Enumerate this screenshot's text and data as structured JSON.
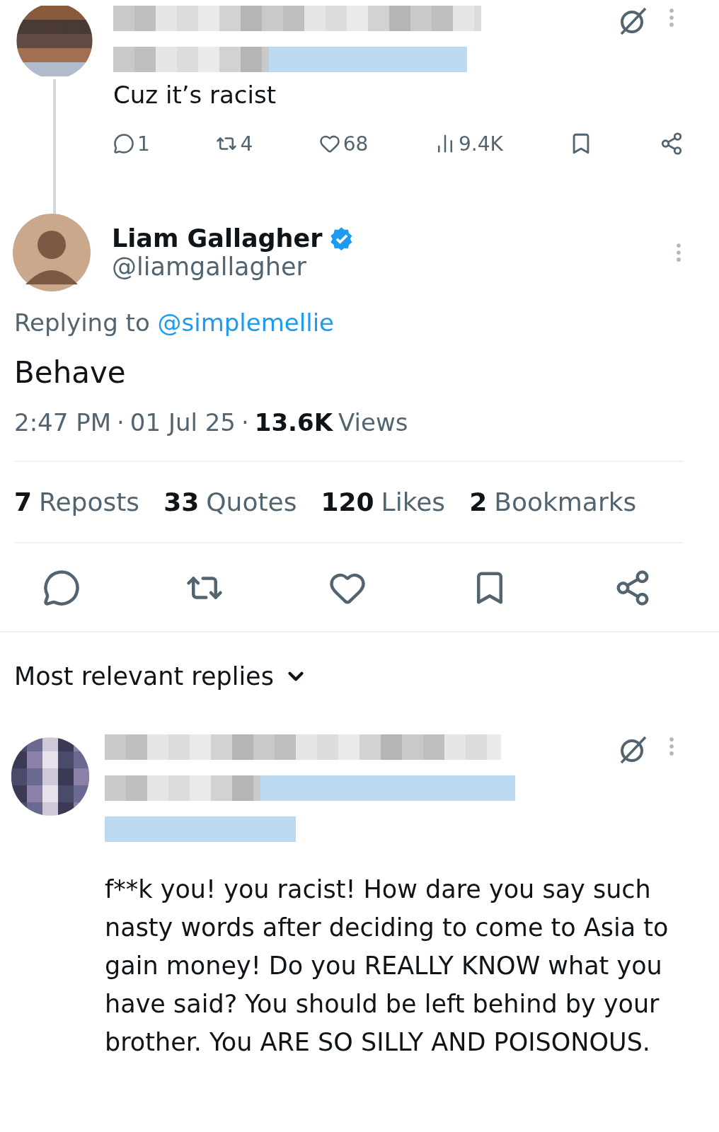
{
  "parent_tweet": {
    "text": "Cuz it’s racist",
    "stats": [
      {
        "kind": "reply",
        "count": "1"
      },
      {
        "kind": "repost",
        "count": "4"
      },
      {
        "kind": "like",
        "count": "68"
      },
      {
        "kind": "views",
        "count": "9.4K"
      }
    ]
  },
  "main_tweet": {
    "name": "Liam Gallagher",
    "handle": "@liamgallagher",
    "replying_prefix": "Replying to",
    "replying_handle": "@simplemellie",
    "text": "Behave",
    "meta": [
      {
        "text": "2:47 PM",
        "bold": false
      },
      {
        "text": "·",
        "bold": false
      },
      {
        "text": "01 Jul 25",
        "bold": false
      },
      {
        "text": "·",
        "bold": false
      },
      {
        "text": "13.6K",
        "bold": true
      },
      {
        "text": "Views",
        "bold": false
      }
    ],
    "stats": [
      {
        "count": "7",
        "label": "Reposts"
      },
      {
        "count": "33",
        "label": "Quotes"
      },
      {
        "count": "120",
        "label": "Likes"
      },
      {
        "count": "2",
        "label": "Bookmarks"
      }
    ]
  },
  "replies_header": {
    "label": "Most relevant replies"
  },
  "reply": {
    "text": "f**k you! you racist! How dare you say such nasty words after deciding to come to Asia to gain money! Do you REALLY KNOW what you have said? You should be left behind by your brother. You ARE SO SILLY AND POISONOUS."
  }
}
